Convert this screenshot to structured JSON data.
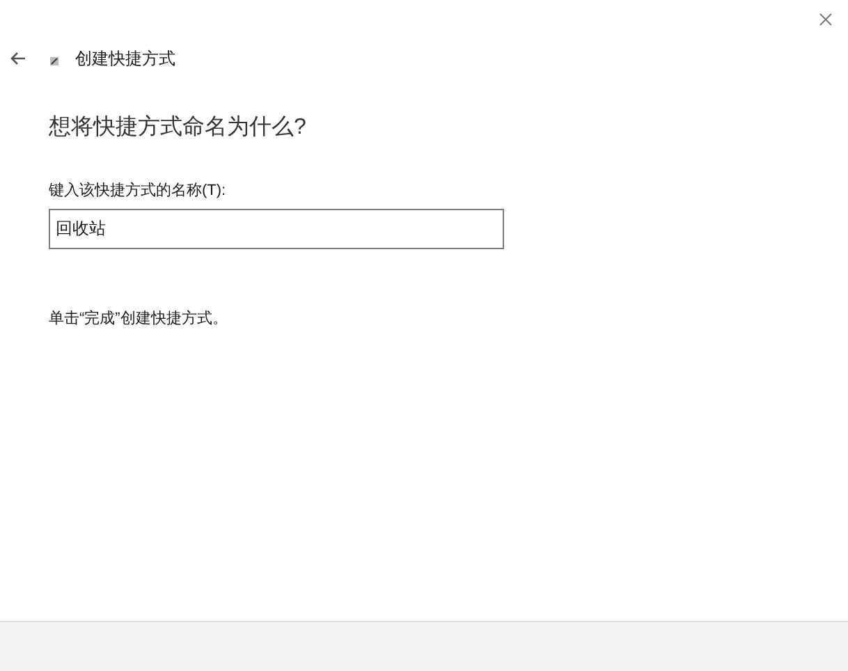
{
  "window": {
    "title": "创建快捷方式"
  },
  "heading": "想将快捷方式命名为什么?",
  "name_field": {
    "label": "键入该快捷方式的名称(T):",
    "value": "回收站"
  },
  "instruction": "单击“完成”创建快捷方式。"
}
